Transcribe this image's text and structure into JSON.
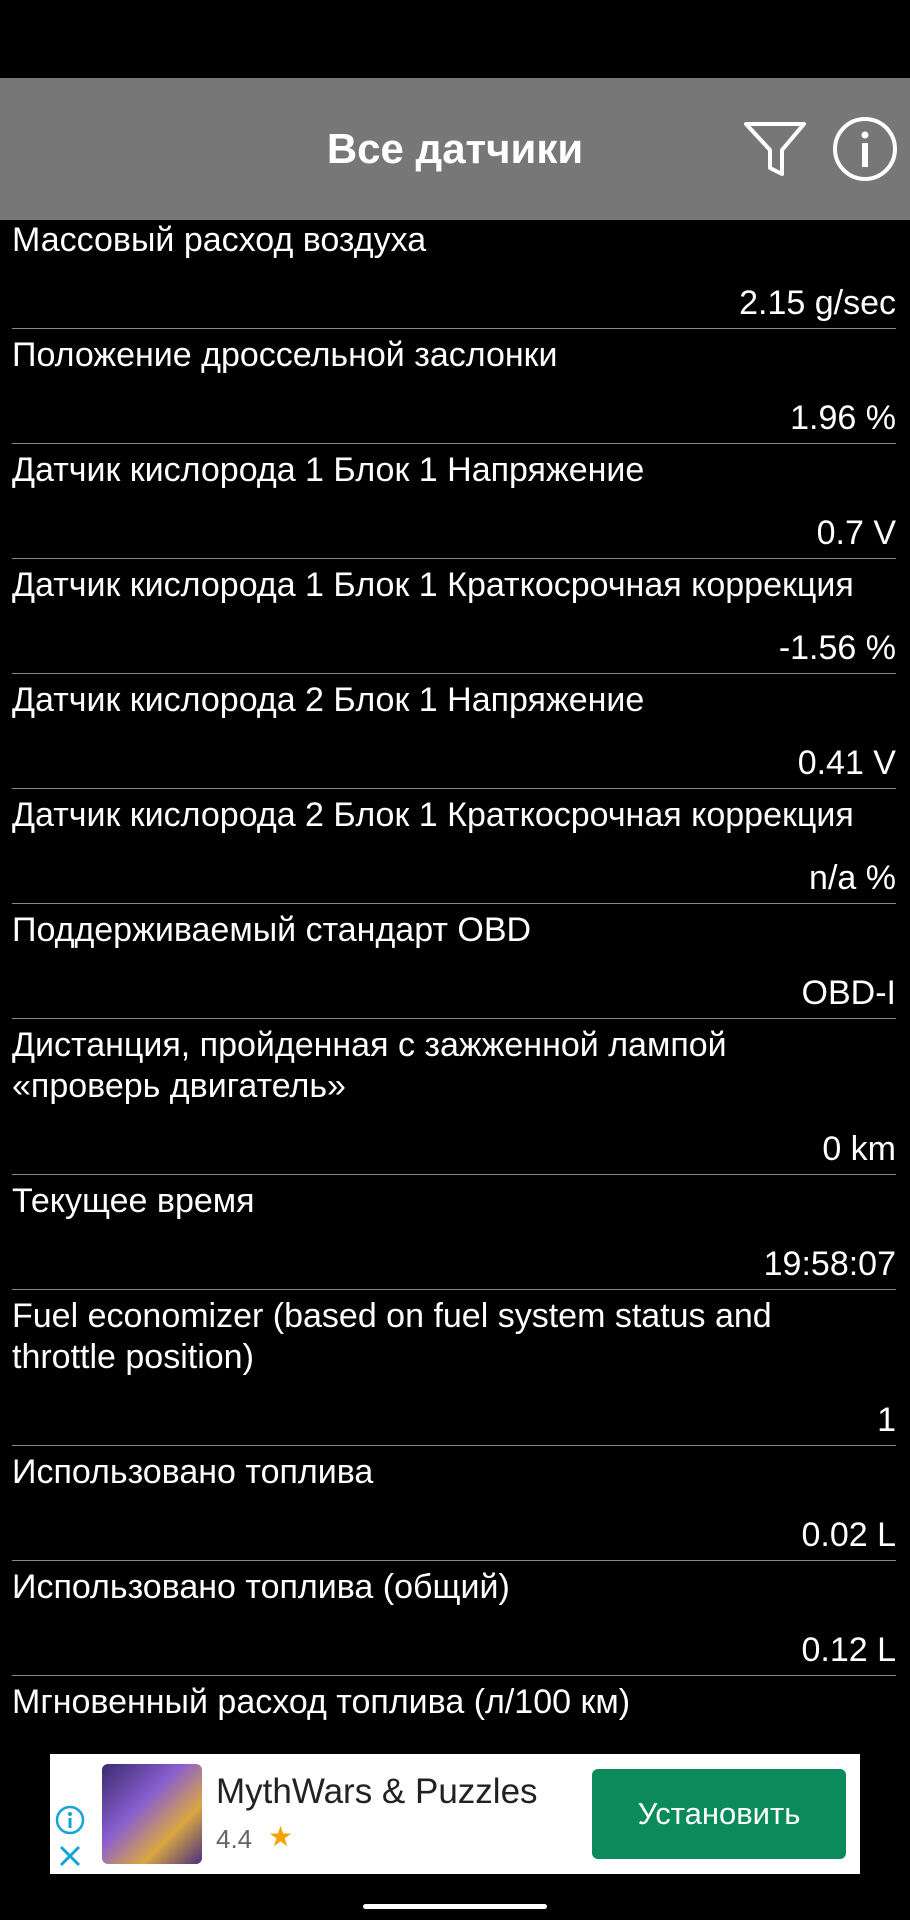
{
  "header": {
    "title": "Все датчики",
    "filter_icon": "filter-icon",
    "info_icon": "info-icon"
  },
  "sensors": [
    {
      "label": "Массовый расход воздуха",
      "value": "2.15 g/sec"
    },
    {
      "label": "Положение дроссельной заслонки",
      "value": "1.96 %"
    },
    {
      "label": "Датчик кислорода 1 Блок 1 Напряжение",
      "value": "0.7 V"
    },
    {
      "label": "Датчик кислорода 1 Блок 1 Краткосрочная коррекция",
      "value": "-1.56 %"
    },
    {
      "label": "Датчик кислорода 2 Блок 1 Напряжение",
      "value": "0.41 V"
    },
    {
      "label": "Датчик кислорода 2 Блок 1 Краткосрочная коррекция",
      "value": "n/a %"
    },
    {
      "label": "Поддерживаемый стандарт OBD",
      "value": "OBD-I"
    },
    {
      "label": "Дистанция, пройденная с зажженной лампой «проверь двигатель»",
      "value": "0 km"
    },
    {
      "label": "Текущее время",
      "value": "19:58:07"
    },
    {
      "label": "Fuel economizer (based on fuel system status and throttle position)",
      "value": "1"
    },
    {
      "label": "Использовано топлива",
      "value": "0.02 L"
    },
    {
      "label": "Использовано топлива (общий)",
      "value": "0.12 L"
    },
    {
      "label": "Мгновенный расход топлива (л/100 км)",
      "value": ""
    }
  ],
  "ad": {
    "app_name": "MythWars & Puzzles",
    "rating": "4.4",
    "install_label": "Установить",
    "info_icon": "ad-info-icon",
    "close_icon": "ad-close-icon"
  }
}
